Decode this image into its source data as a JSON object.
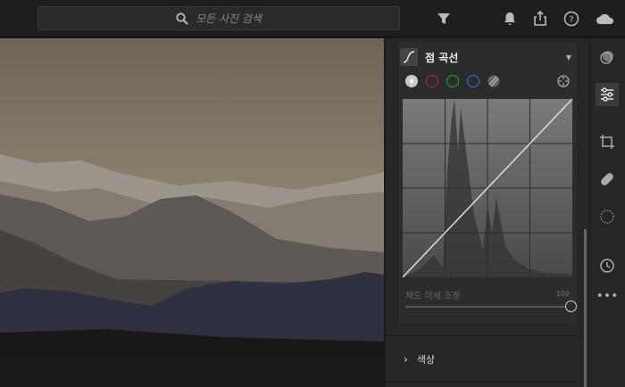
{
  "search": {
    "placeholder": "모든 사진 검색"
  },
  "curve": {
    "title": "점 곡선",
    "saturation_label": "채도 미세 조정",
    "saturation_value": "100",
    "saturation_fraction": 1.0
  },
  "color_section": {
    "label": "색상"
  },
  "colors": {
    "accent": "#ffffff",
    "red": "#c8202a",
    "green": "#1fa83a",
    "blue": "#3a6fd8"
  }
}
